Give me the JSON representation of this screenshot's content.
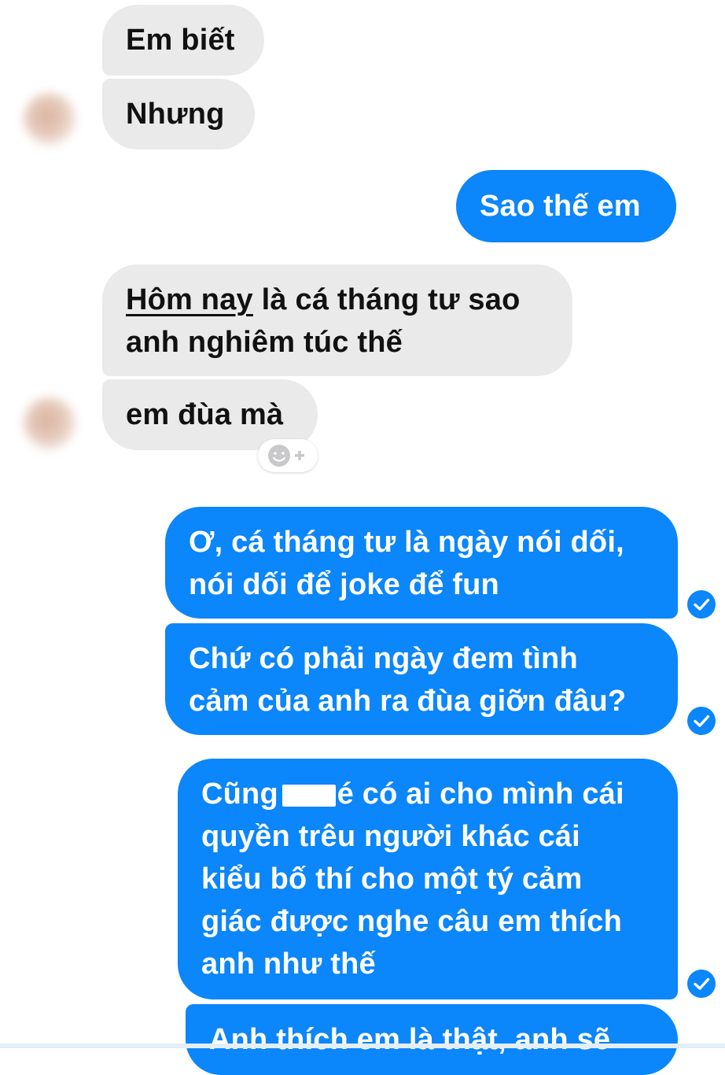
{
  "conversation": {
    "messages": [
      {
        "from": "them",
        "lines": [
          "Em biết"
        ]
      },
      {
        "from": "them",
        "lines": [
          "Nhưng"
        ]
      },
      {
        "from": "me",
        "lines": [
          "Sao thế em"
        ]
      },
      {
        "from": "them",
        "lines_first_underlined": "Hôm nay",
        "lines_first_rest": " là cá tháng tư sao",
        "lines": [
          "anh nghiêm túc thế"
        ]
      },
      {
        "from": "them",
        "lines": [
          "em đùa mà"
        ]
      },
      {
        "from": "me",
        "lines": [
          "Ơ, cá tháng tư là ngày nói dối,",
          "nói dối để joke để fun"
        ]
      },
      {
        "from": "me",
        "lines": [
          "Chứ có phải ngày đem tình",
          "cảm của anh ra đùa giỡn đâu?"
        ]
      },
      {
        "from": "me",
        "line1_a": "Cũng",
        "line1_b": "é có ai cho mình cái",
        "lines": [
          "quyền trêu người khác cái",
          "kiểu bố thí cho một tý cảm",
          "giác được nghe câu em thích",
          "anh như thế"
        ]
      },
      {
        "from": "me",
        "lines": [
          "Anh thích em là thật, anh sẽ"
        ]
      }
    ]
  },
  "icons": {
    "avatar": "avatar-blurred",
    "reaction": "add-reaction-icon",
    "read_receipt": "check-circle-icon"
  },
  "colors": {
    "incoming_bubble": "#eaeaeb",
    "outgoing_bubble": "#0b86fb",
    "incoming_text": "#111111",
    "outgoing_text": "#ffffff"
  }
}
